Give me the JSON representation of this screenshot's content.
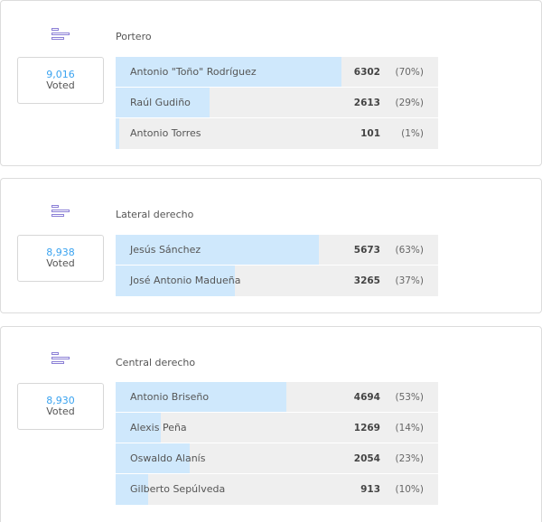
{
  "polls": [
    {
      "title": "Portero",
      "total_votes": "9,016",
      "voted_label": "Voted",
      "options": [
        {
          "name": "Antonio \"Toño\" Rodríguez",
          "votes": "6302",
          "percent": "(70%)",
          "share": 0.7
        },
        {
          "name": "Raúl Gudiño",
          "votes": "2613",
          "percent": "(29%)",
          "share": 0.29
        },
        {
          "name": "Antonio Torres",
          "votes": "101",
          "percent": "(1%)",
          "share": 0.01
        }
      ]
    },
    {
      "title": "Lateral derecho",
      "total_votes": "8,938",
      "voted_label": "Voted",
      "options": [
        {
          "name": "Jesús Sánchez",
          "votes": "5673",
          "percent": "(63%)",
          "share": 0.63
        },
        {
          "name": "José Antonio Madueña",
          "votes": "3265",
          "percent": "(37%)",
          "share": 0.37
        }
      ]
    },
    {
      "title": "Central derecho",
      "total_votes": "8,930",
      "voted_label": "Voted",
      "options": [
        {
          "name": "Antonio Briseño",
          "votes": "4694",
          "percent": "(53%)",
          "share": 0.53
        },
        {
          "name": "Alexis Peña",
          "votes": "1269",
          "percent": "(14%)",
          "share": 0.14
        },
        {
          "name": "Oswaldo Alanís",
          "votes": "2054",
          "percent": "(23%)",
          "share": 0.23
        },
        {
          "name": "Gilberto Sepúlveda",
          "votes": "913",
          "percent": "(10%)",
          "share": 0.1
        }
      ]
    }
  ],
  "icons": {
    "poll": "poll-bars-icon"
  },
  "colors": {
    "fill": "#cfe8fc",
    "track": "#efefef",
    "count": "#3aa3f0",
    "icon": "#8b7fd6"
  }
}
